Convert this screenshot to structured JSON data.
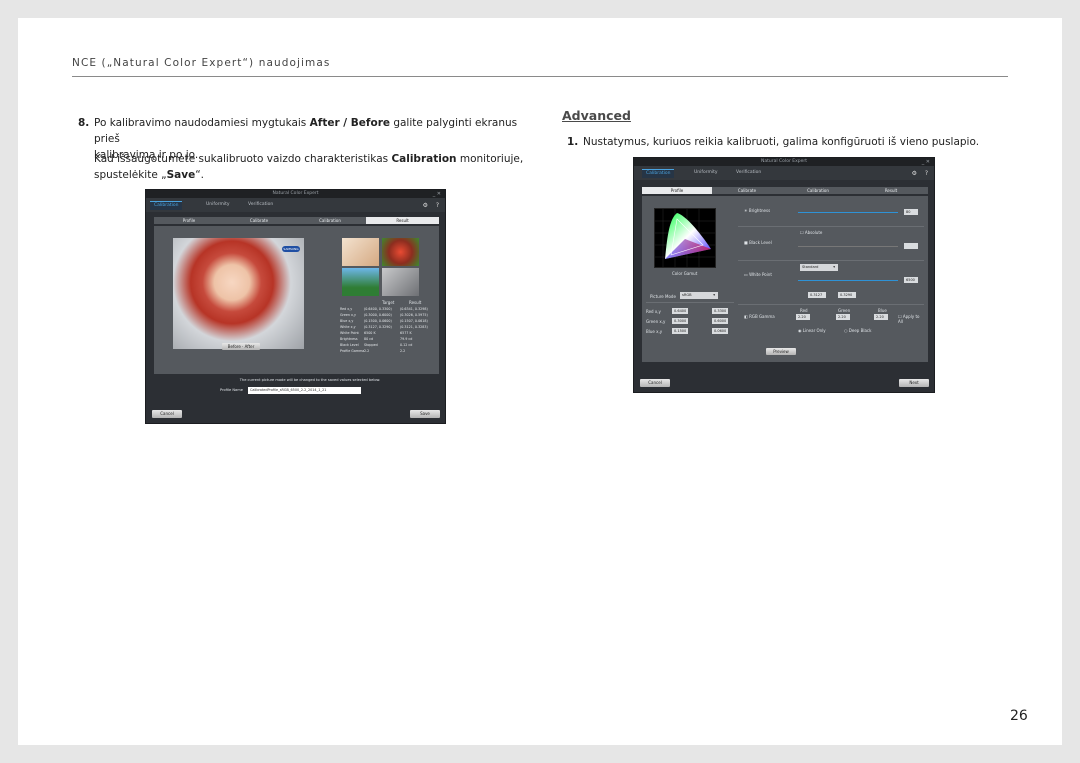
{
  "header": "NCE („Natural Color Expert“) naudojimas",
  "page_number": "26",
  "left": {
    "item_number": "8.",
    "p1": {
      "t1": "Po kalibravimo naudodamiesi mygtukais ",
      "b1": "After / Before",
      "t2": " galite palyginti ekranus prieš",
      "t3": "kalibravimą ir po jo."
    },
    "p2": {
      "t1": "Kad išsaugotumėte sukalibruoto vaizdo charakteristikas ",
      "b1": "Calibration",
      "t2": " monitoriuje,",
      "t3": "spustelėkite „",
      "b2": "Save",
      "t4": "“."
    }
  },
  "right": {
    "heading": "Advanced",
    "item_number": "1.",
    "text": "Nustatymus, kuriuos reikia kalibruoti, galima konfigūruoti iš vieno puslapio."
  },
  "shot1": {
    "title": "Natural Color Expert",
    "tabs": [
      "Calibration",
      "Uniformity",
      "Verification"
    ],
    "steps": [
      "Profile",
      "Calibrate",
      "Calibration",
      "Result"
    ],
    "result_header": [
      "Target",
      "Result"
    ],
    "rows": [
      [
        "Red x,y",
        "(0.6400, 0.3300)",
        "(0.6341, 0.3298)"
      ],
      [
        "Green x,y",
        "(0.3000, 0.6000)",
        "(0.3026, 0.5975)"
      ],
      [
        "Blue x,y",
        "(0.1500, 0.0600)",
        "(0.1507, 0.0618)"
      ],
      [
        "White x,y",
        "(0.3127, 0.3290)",
        "(0.3121, 0.3283)"
      ],
      [
        "White Point",
        "6500 K",
        "6577 K"
      ],
      [
        "Brightness",
        "80 cd",
        "79.9 cd"
      ],
      [
        "Black Level",
        "Stopped",
        "0.12 cd"
      ],
      [
        "Profile Gamma",
        "2.2",
        "2.2"
      ]
    ],
    "before_label": "Before",
    "after_label": "After",
    "note": "The current picture mode will be changed to the saved values selected below.",
    "profile_name_label": "Profile Name",
    "profile_name_value": "CalibratedProfile_sRGB_6500_2.2_2014_1_21",
    "cancel": "Cancel",
    "save": "Save",
    "brand": "SAMSUNG"
  },
  "shot2": {
    "title": "Natural Color Expert",
    "tabs": [
      "Calibration",
      "Uniformity",
      "Verification"
    ],
    "steps": [
      "Profile",
      "Calibrate",
      "Calibration",
      "Result"
    ],
    "brightness_label": "Brightness",
    "brightness_value": "80",
    "black_level_label": "Black Level",
    "absolute_label": "Absolute",
    "white_point_label": "White Point",
    "white_point_mode": "Standard",
    "white_point_value": "6500",
    "x_value": "0.3127",
    "y_value": "0.3290",
    "color_gamut_label": "Color Gamut",
    "picture_mode_label": "Picture Mode",
    "picture_mode_value": "sRGB",
    "red_x": "0.6400",
    "red_y": "0.3300",
    "green_x": "0.3000",
    "green_y": "0.6000",
    "blue_x": "0.1500",
    "blue_y": "0.0600",
    "gamma_label": "RGB Gamma",
    "gamma_red": "2.20",
    "gamma_green": "2.20",
    "gamma_blue": "2.20",
    "gamma_col_labels": [
      "Red",
      "Green",
      "Blue"
    ],
    "apply_all": "Apply to All",
    "linear_label": "Linear Only",
    "deep_label": "Deep Black",
    "preview": "Preview",
    "cancel": "Cancel",
    "next": "Next"
  }
}
